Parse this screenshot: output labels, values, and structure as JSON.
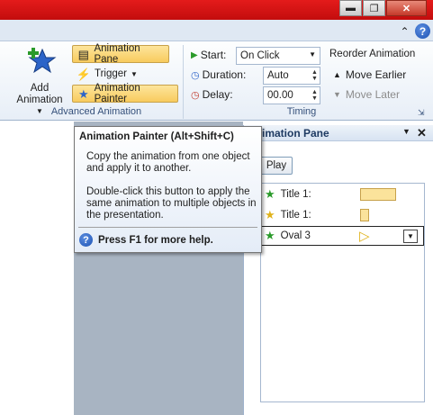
{
  "ribbon": {
    "add_animation": {
      "line1": "Add",
      "line2": "Animation"
    },
    "animation_pane": "Animation Pane",
    "trigger": "Trigger",
    "animation_painter": "Animation Painter",
    "advanced_group_label": "Advanced Animation",
    "timing": {
      "start_label": "Start:",
      "start_value": "On Click",
      "duration_label": "Duration:",
      "duration_value": "Auto",
      "delay_label": "Delay:",
      "delay_value": "00.00",
      "group_label": "Timing"
    },
    "reorder": {
      "title": "Reorder Animation",
      "move_earlier": "Move Earlier",
      "move_later": "Move Later"
    }
  },
  "tooltip": {
    "title": "Animation Painter (Alt+Shift+C)",
    "para1": "Copy the animation from one object and apply it to another.",
    "para2": "Double-click this button to apply the same animation to multiple objects in the presentation.",
    "help": "Press F1 for more help."
  },
  "pane": {
    "title": "Animation Pane",
    "play": "Play",
    "items": [
      {
        "label": "Title 1:"
      },
      {
        "label": "Title 1:"
      },
      {
        "label": "Oval 3"
      }
    ]
  },
  "colors": {
    "titlebar": "#d01212",
    "active_button": "#f8cb5e",
    "timeline_bar": "#fbe39b"
  }
}
